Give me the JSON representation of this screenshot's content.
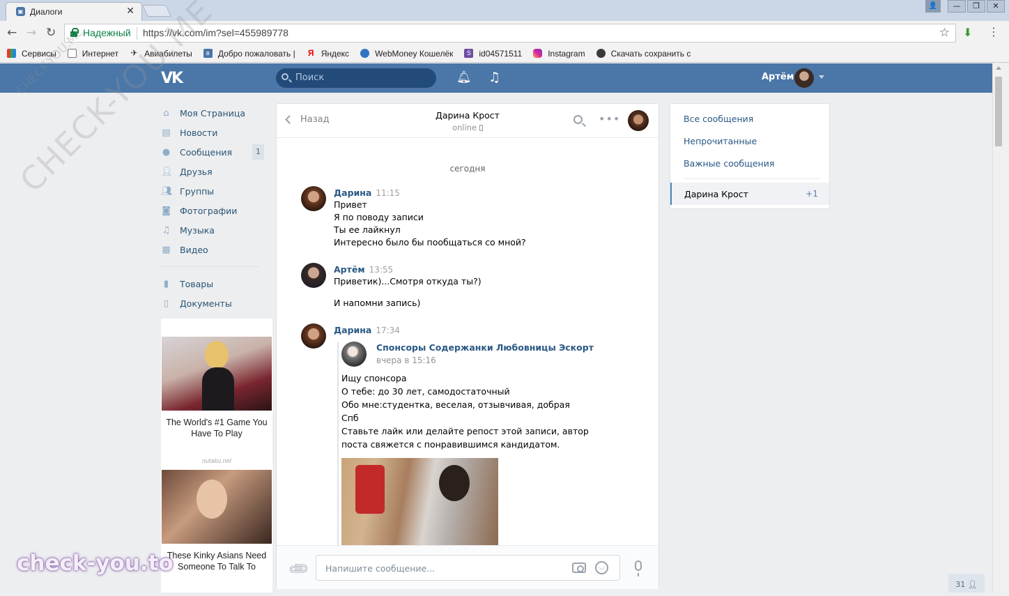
{
  "browser": {
    "tab_title": "Диалоги",
    "tab_close": "✕",
    "secure_label": "Надежный",
    "url": "https://vk.com/im?sel=455989778",
    "window_controls": [
      "—",
      "❐",
      "✕"
    ],
    "bookmarks": [
      {
        "label": "Сервисы",
        "icon": "apps-grid-icon"
      },
      {
        "label": "Интернет",
        "icon": "page-icon"
      },
      {
        "label": "Авиабилеты",
        "icon": "plane-icon"
      },
      {
        "label": "Добро пожаловать |",
        "icon": "vk-icon"
      },
      {
        "label": "Яндекс",
        "icon": "yandex-icon"
      },
      {
        "label": "WebMoney Кошелёк",
        "icon": "webmoney-icon"
      },
      {
        "label": "id04571511",
        "icon": "s-icon"
      },
      {
        "label": "Instagram",
        "icon": "instagram-icon"
      },
      {
        "label": "Скачать сохранить с",
        "icon": "download-site-icon"
      }
    ]
  },
  "vk_header": {
    "logo": "VK",
    "search_placeholder": "Поиск",
    "user_name": "Артём"
  },
  "left_menu": {
    "items": [
      {
        "label": "Моя Страница",
        "icon": "home-icon"
      },
      {
        "label": "Новости",
        "icon": "news-icon"
      },
      {
        "label": "Сообщения",
        "icon": "messages-icon",
        "badge": "1"
      },
      {
        "label": "Друзья",
        "icon": "friends-icon"
      },
      {
        "label": "Группы",
        "icon": "groups-icon"
      },
      {
        "label": "Фотографии",
        "icon": "camera-icon"
      },
      {
        "label": "Музыка",
        "icon": "music-icon"
      },
      {
        "label": "Видео",
        "icon": "video-icon"
      }
    ],
    "items2": [
      {
        "label": "Товары",
        "icon": "shopping-bag-icon"
      },
      {
        "label": "Документы",
        "icon": "document-icon"
      }
    ]
  },
  "ads": {
    "ad1_text": "The World's #1 Game You Have To Play",
    "ad_source": "nutaku.net",
    "ad2_text": "These Kinky Asians Need Someone To Talk To"
  },
  "chat": {
    "back_label": "Назад",
    "peer_name": "Дарина Крост",
    "peer_status": "online",
    "day_label": "сегодня",
    "messages": [
      {
        "author": "Дарина",
        "time": "11:15",
        "lines": [
          "Привет",
          "Я по поводу записи",
          "Ты ее лайкнул",
          "Интересно было бы пообщаться со мной?"
        ]
      },
      {
        "author": "Артём",
        "time": "13:55",
        "lines": [
          "Приветик)...Смотря откуда ты?)",
          "И напомни запись)"
        ]
      },
      {
        "author": "Дарина",
        "time": "17:34",
        "lines": []
      }
    ],
    "repost": {
      "group_name": "Спонсоры Содержанки Любовницы Эскорт",
      "date": "вчера в 15:16",
      "lines": [
        "Ищу спонсора",
        "О тебе: до 30 лет, самодостаточный",
        "Обо мне:студентка, веселая, отзывчивая, добрая",
        "Спб",
        "Ставьте лайк или делайте репост этой записи, автор",
        "поста свяжется с понравившимся кандидатом."
      ]
    },
    "input_placeholder": "Напишите сообщение..."
  },
  "right_panel": {
    "links": [
      "Все сообщения",
      "Непрочитанные",
      "Важные сообщения"
    ],
    "active_dialog": "Дарина Крост",
    "active_count": "+1"
  },
  "online_count": "31",
  "watermarks": {
    "diagonal": "CHECK-YOU.ME",
    "small": "CHECK-YOU.ME",
    "bottom": "check-you.to"
  }
}
